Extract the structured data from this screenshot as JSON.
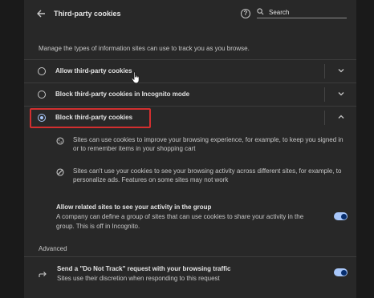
{
  "header": {
    "title": "Third-party cookies",
    "search_placeholder": "Search",
    "help_glyph": "?"
  },
  "intro": "Manage the types of information sites can use to track you as you browse.",
  "options": [
    {
      "label": "Allow third-party cookies",
      "checked": false
    },
    {
      "label": "Block third-party cookies in Incognito mode",
      "checked": false
    },
    {
      "label": "Block third-party cookies",
      "checked": true
    }
  ],
  "details": [
    {
      "icon": "cookie-icon",
      "text": "Sites can use cookies to improve your browsing experience, for example, to keep you signed in or to remember items in your shopping cart"
    },
    {
      "icon": "block-icon",
      "text": "Sites can't use your cookies to see your browsing activity across different sites, for example, to personalize ads. Features on some sites may not work"
    }
  ],
  "related_sites": {
    "title": "Allow related sites to see your activity in the group",
    "description": "A company can define a group of sites that can use cookies to share your activity in the group. This is off in Incognito.",
    "enabled": true
  },
  "advanced": {
    "heading": "Advanced",
    "dnt_title": "Send a \"Do Not Track\" request with your browsing traffic",
    "dnt_description": "Sites use their discretion when responding to this request",
    "dnt_enabled": true
  },
  "colors": {
    "accent": "#a8c7fa",
    "highlight_border": "#d32f2f",
    "panel_bg": "#282828"
  }
}
